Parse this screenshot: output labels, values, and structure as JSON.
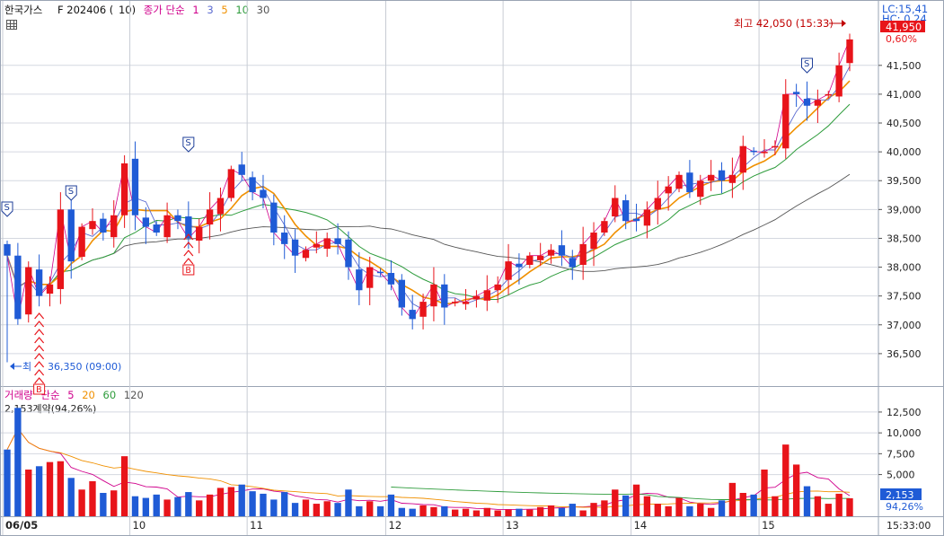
{
  "header": {
    "instrument": "한국가스",
    "contract": "F 202406 (",
    "period": "10)",
    "ma_label": "종가 단순",
    "ma_periods": [
      "1",
      "3",
      "5",
      "10",
      "30"
    ]
  },
  "volume_header": {
    "title": "거래량",
    "ma_label": "단순",
    "ma_periods": [
      "5",
      "20",
      "60",
      "120"
    ],
    "summary": "2,153계약(94,26%)"
  },
  "right_panel": {
    "lc": "LC:15,41",
    "hc": "HC: 0,24",
    "last_price": "41,950",
    "change": "0,60%",
    "last_volume": "2,153",
    "volume_ratio": "94,26%",
    "time": "15:33:00"
  },
  "annotations": {
    "high": "최고 42,050 (15:33)",
    "low_prefix": "최",
    "low": "36,350 (09:00)",
    "signal_s": "S",
    "signal_b": "B"
  },
  "colors": {
    "up": "#e8141a",
    "down": "#1f5bd6",
    "ma1": "#d0008c",
    "ma3": "#5a6ad0",
    "ma5": "#f09000",
    "ma10": "#2e9c3c",
    "ma30": "#555555"
  },
  "chart_data": [
    {
      "type": "candlestick",
      "title": "한국가스 F 202406 (10)",
      "x_dates": [
        "06/05",
        "10",
        "11",
        "12",
        "13",
        "14",
        "15"
      ],
      "ylim": [
        36000,
        42400
      ],
      "y_ticks": [
        "36,500",
        "37,000",
        "37,500",
        "38,000",
        "38,500",
        "39,000",
        "39,500",
        "40,000",
        "40,500",
        "41,000",
        "41,500"
      ],
      "grid": true,
      "series": [
        {
          "name": "Close",
          "values": [
            38200,
            37100,
            38000,
            37500,
            37700,
            39000,
            38100,
            38700,
            38800,
            38600,
            38900,
            39800,
            38900,
            38700,
            38600,
            38900,
            38800,
            38500,
            38700,
            39000,
            39200,
            39700,
            39600,
            39300,
            39200,
            38600,
            38400,
            38200,
            38300,
            38400,
            38500,
            38400,
            38000,
            37600,
            38000,
            37900,
            37700,
            37300,
            37100,
            37400,
            37700,
            37300,
            37400,
            37400,
            37500,
            37600,
            37700,
            38100,
            38000,
            38200,
            38200,
            38300,
            38200,
            38000,
            38400,
            38600,
            38800,
            39200,
            38800,
            38800,
            39000,
            39200,
            39400,
            39600,
            39300,
            39500,
            39600,
            39500,
            39600,
            40100,
            40000,
            40000,
            40100,
            41000,
            41000,
            40800,
            40900,
            41000,
            41500,
            41950
          ]
        },
        {
          "name": "1",
          "values": [
            38200,
            37100,
            38000,
            37500,
            37700,
            39000,
            38100,
            38700,
            38800,
            38600,
            38900,
            39800,
            38900,
            38700,
            38600,
            38900,
            38800,
            38500,
            38700,
            39000,
            39200,
            39700,
            39600,
            39300,
            39200,
            38600,
            38400,
            38200,
            38300,
            38400,
            38500,
            38400,
            38000,
            37600,
            38000,
            37900,
            37700,
            37300,
            37100,
            37400,
            37700,
            37300,
            37400,
            37400,
            37500,
            37600,
            37700,
            38100,
            38000,
            38200,
            38200,
            38300,
            38200,
            38000,
            38400,
            38600,
            38800,
            39200,
            38800,
            38800,
            39000,
            39200,
            39400,
            39600,
            39300,
            39500,
            39600,
            39500,
            39600,
            40100,
            40000,
            40000,
            40100,
            41000,
            41000,
            40800,
            40900,
            41000,
            41500,
            41950
          ]
        },
        {
          "name": "3",
          "values": []
        },
        {
          "name": "5",
          "values": []
        },
        {
          "name": "10",
          "values": []
        },
        {
          "name": "30",
          "values": []
        }
      ],
      "high": 42050,
      "low": 36350
    },
    {
      "type": "bar",
      "title": "거래량",
      "ylim": [
        0,
        14000
      ],
      "y_ticks": [
        "5,000",
        "7,500",
        "10,000",
        "12,500"
      ],
      "series": [
        {
          "name": "Volume",
          "values": [
            8000,
            13000,
            5600,
            6000,
            6500,
            6600,
            4600,
            3200,
            4200,
            2800,
            3100,
            7200,
            2400,
            2200,
            2600,
            2000,
            2300,
            2900,
            1900,
            2600,
            3400,
            3500,
            3800,
            3000,
            2700,
            2000,
            2900,
            1600,
            2000,
            1500,
            1800,
            1600,
            3200,
            1200,
            1800,
            1200,
            2600,
            1000,
            900,
            1300,
            1100,
            1200,
            800,
            900,
            700,
            1000,
            700,
            800,
            900,
            800,
            1100,
            1300,
            1000,
            1500,
            700,
            1600,
            1900,
            3200,
            2500,
            3800,
            2400,
            1500,
            1200,
            2200,
            1200,
            1500,
            1000,
            1900,
            4000,
            2800,
            2600,
            5600,
            2400,
            8600,
            6200,
            3600,
            2400,
            1500,
            2700,
            2153
          ]
        },
        {
          "name": "5",
          "values": []
        },
        {
          "name": "20",
          "values": []
        },
        {
          "name": "60",
          "values": []
        },
        {
          "name": "120",
          "values": []
        }
      ]
    }
  ]
}
